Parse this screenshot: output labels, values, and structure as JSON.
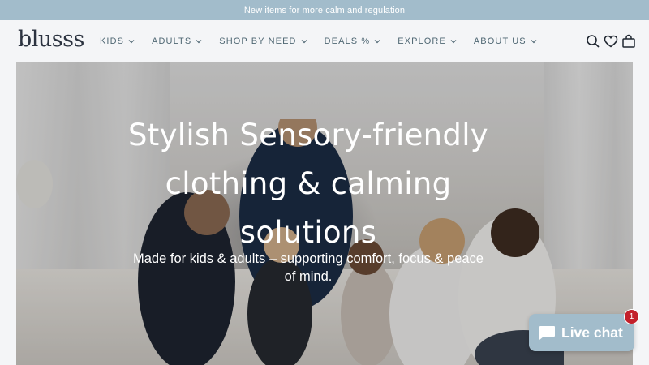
{
  "announcement": {
    "text": "New items for more calm and regulation"
  },
  "header": {
    "logo": "blusss",
    "nav": [
      {
        "label": "KIDS"
      },
      {
        "label": "ADULTS"
      },
      {
        "label": "SHOP BY NEED"
      },
      {
        "label": "DEALS %"
      },
      {
        "label": "EXPLORE"
      },
      {
        "label": "ABOUT US"
      }
    ],
    "icons": [
      "search-icon",
      "heart-icon",
      "bag-icon"
    ]
  },
  "hero": {
    "title_line1": "Stylish Sensory-friendly",
    "title_line2": "clothing & calming",
    "title_line3": "solutions",
    "subtitle_line1": "Made for kids & adults – supporting comfort, focus & peace",
    "subtitle_line2": "of mind."
  },
  "chat": {
    "label": "Live chat",
    "badge": "1"
  },
  "colors": {
    "accent": "#a2bccb",
    "nav_text": "#4f6773",
    "logo": "#2c3340",
    "badge": "#c3202b"
  }
}
